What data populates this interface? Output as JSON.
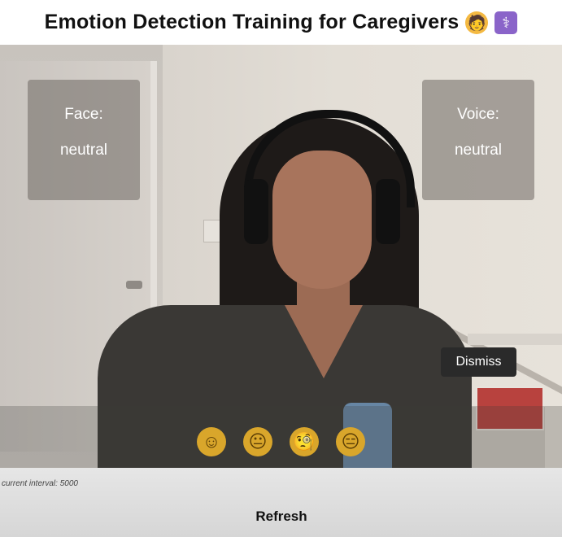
{
  "header": {
    "title": "Emotion Detection Training for Caregivers",
    "emoji_1": "🧑",
    "emoji_2": "⚕"
  },
  "video": {
    "face_panel": {
      "label": "Face:",
      "value": "neutral"
    },
    "voice_panel": {
      "label": "Voice:",
      "value": "neutral"
    },
    "dismiss_label": "Dismiss",
    "emoji_choices": [
      {
        "glyph": "☺",
        "name": "smiling-face"
      },
      {
        "glyph": "😐",
        "name": "neutral-face"
      },
      {
        "glyph": "🧐",
        "name": "monocle-face"
      },
      {
        "glyph": "😑",
        "name": "expressionless-face"
      }
    ]
  },
  "footer": {
    "interval_text": "current interval: 5000",
    "refresh_label": "Refresh"
  },
  "colors": {
    "emoji_yellow": "#d9a62b",
    "panel_bg": "rgba(110,104,98,0.55)",
    "dismiss_bg": "#2a2a2a"
  }
}
